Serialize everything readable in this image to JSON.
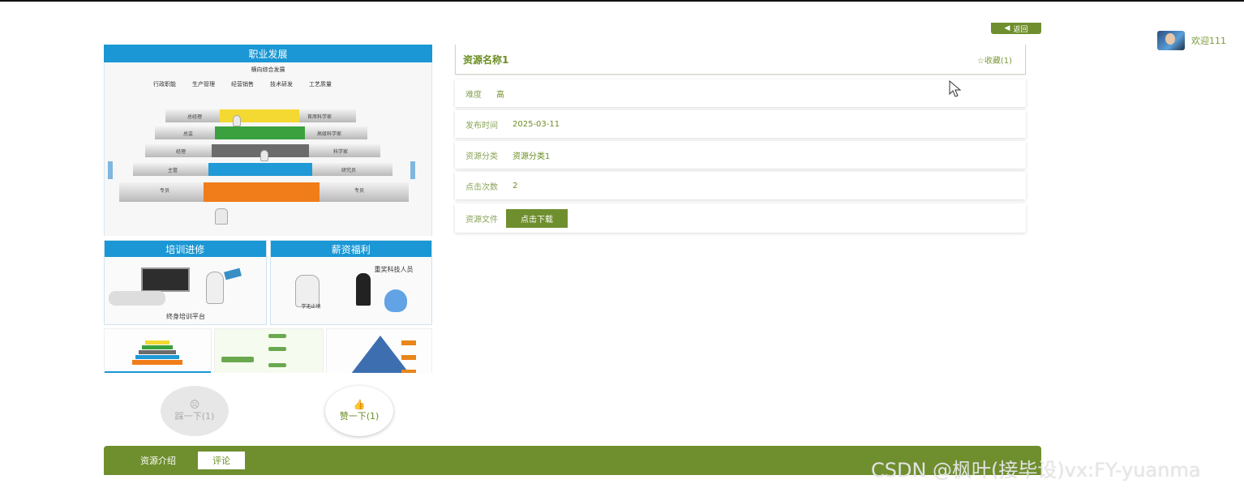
{
  "header": {
    "welcome": "欢迎111",
    "back_label": "返回"
  },
  "image": {
    "top_banner": "职业发展",
    "subtitle": "横向综合发展",
    "categories": [
      "行政职能",
      "生产管理",
      "经营销售",
      "技术研发",
      "工艺质量"
    ],
    "left_levels": [
      "总经理",
      "总监",
      "经理",
      "主管",
      "专员"
    ],
    "right_levels": [
      "首席科学家",
      "高级科学家",
      "科学家",
      "研究员",
      "专员"
    ],
    "panel_left_banner": "培训进修",
    "panel_left_caption": "终身培训平台",
    "panel_right_banner": "薪资福利",
    "panel_right_caption": "重奖科技人员",
    "panel_right_board": "学无止境"
  },
  "detail": {
    "title": "资源名称1",
    "favorite": "收藏(1)",
    "rows": [
      {
        "label": "难度",
        "value": "高"
      },
      {
        "label": "发布时间",
        "value": "2025-03-11"
      },
      {
        "label": "资源分类",
        "value": "资源分类1"
      },
      {
        "label": "点击次数",
        "value": "2"
      }
    ],
    "file_label": "资源文件",
    "download_label": "点击下载"
  },
  "actions": {
    "dislike": "踩一下(1)",
    "like": "赞一下(1)"
  },
  "tabs": [
    "资源介绍",
    "评论"
  ],
  "active_tab": 1,
  "watermark": "CSDN @枫叶(接毕设)vx:FY-yuanma",
  "colors": {
    "accent": "#6f8f2e",
    "text": "#6b8e23",
    "banner_blue": "#1a97d4"
  }
}
